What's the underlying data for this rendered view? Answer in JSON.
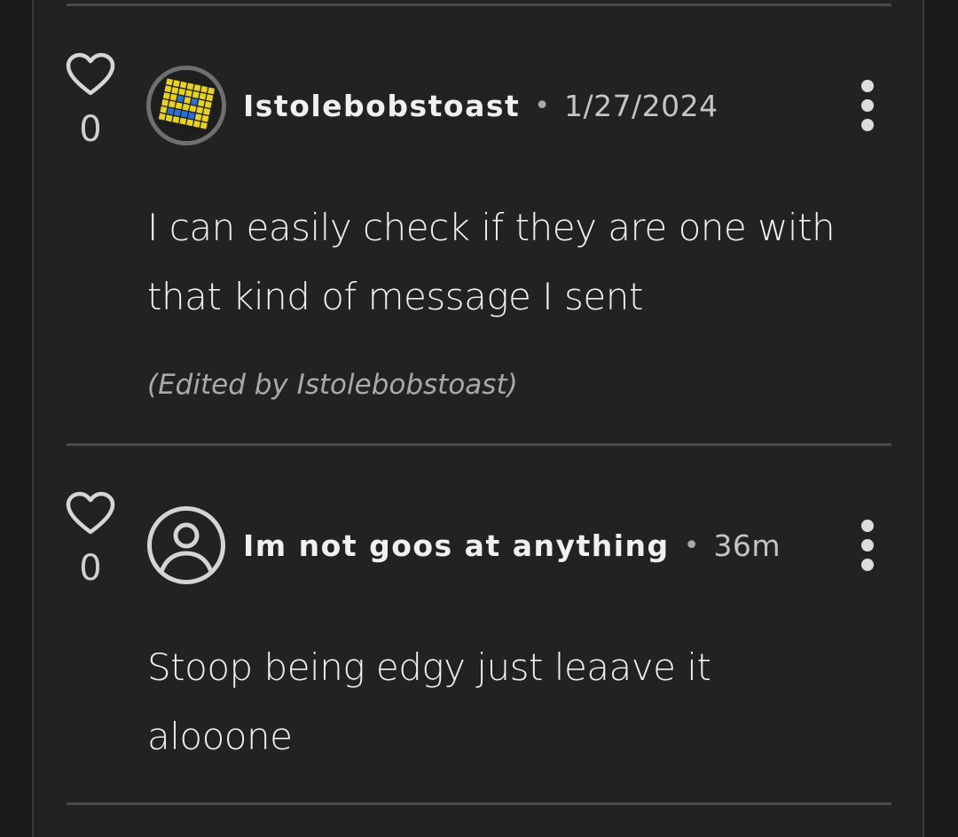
{
  "comments": [
    {
      "likes": "0",
      "username": "Istolebobstoast",
      "separator": "•",
      "timestamp": "1/27/2024",
      "body": "I can easily check if they are one with that kind of message I sent",
      "edited_note": "(Edited by Istolebobstoast)",
      "avatar": "pixel-grid-avatar"
    },
    {
      "likes": "0",
      "username": "Im not goos at anything",
      "separator": "•",
      "timestamp": "36m",
      "body": "Stoop being edgy just leaave it alooone",
      "avatar": "default-user-icon"
    }
  ],
  "colors": {
    "background": "#1a1a1a",
    "panel": "#222222",
    "divider": "#4a4a4a",
    "text": "#f0f0f0",
    "muted": "#a9a9a9",
    "avatar_yellow": "#e8d21a",
    "avatar_blue": "#2b6fd6"
  },
  "icons": [
    "heart-icon",
    "more-vertical-icon",
    "user-circle-icon"
  ]
}
